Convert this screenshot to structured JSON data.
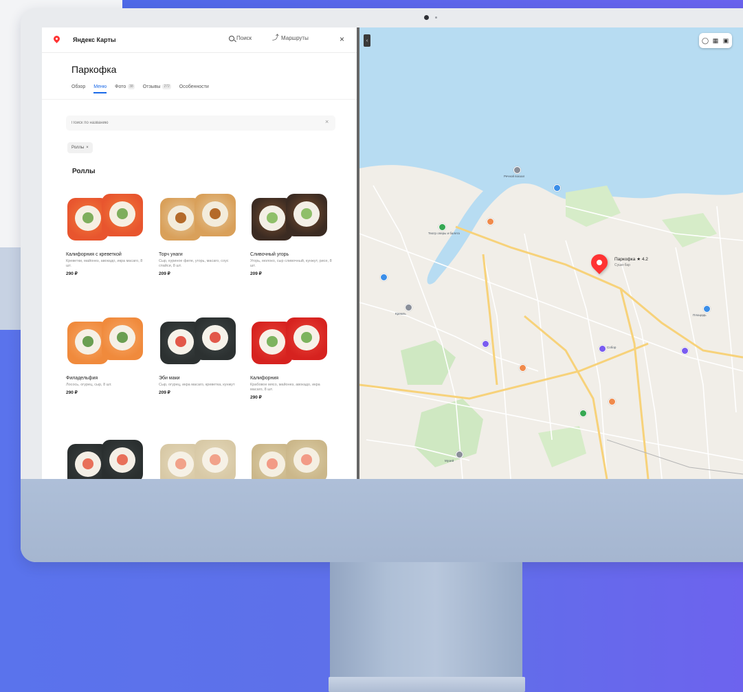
{
  "app": {
    "brand": "Яндекс Карты",
    "search_label": "Поиск",
    "route_label": "Маршруты",
    "close_label": "×"
  },
  "place": {
    "name": "Паркофка",
    "tabs": [
      {
        "label": "Обзор",
        "badge": ""
      },
      {
        "label": "Меню",
        "badge": ""
      },
      {
        "label": "Фото",
        "badge": "38"
      },
      {
        "label": "Отзывы",
        "badge": "272"
      },
      {
        "label": "Особенности",
        "badge": ""
      }
    ],
    "active_tab": "Меню"
  },
  "menu": {
    "search_placeholder": "Поиск по названию",
    "filter_chip": "Роллы",
    "section_title": "Роллы",
    "items": [
      {
        "name": "Калифорния с креветкой",
        "desc": "Креветки, майонез, авокадо, икра масаго, 8 шт.",
        "price": "290 ₽",
        "colors": [
          "#e8552e",
          "#f07a3a",
          "#f6efe2",
          "#7fae5d"
        ]
      },
      {
        "name": "Торч унаги",
        "desc": "Сыр, куриное филе, угорь, масаго, соус спайси, 8 шт.",
        "price": "209 ₽",
        "colors": [
          "#d9a05a",
          "#e6c89a",
          "#f3ecdc",
          "#b46a2a"
        ]
      },
      {
        "name": "Сливочный угорь",
        "desc": "Угорь, молоко, сыр сливочный, кунжут, рисе, 8 шт.",
        "price": "209 ₽",
        "colors": [
          "#3b2b22",
          "#7a4f30",
          "#f3efe6",
          "#8fbf6a"
        ]
      },
      {
        "name": "Филадельфия",
        "desc": "Лосось, огурец, сыр, 8 шт.",
        "price": "290 ₽",
        "colors": [
          "#f08a3c",
          "#f6a868",
          "#f5f0e6",
          "#6a9e52"
        ]
      },
      {
        "name": "Эби маки",
        "desc": "Сыр, огурец, икра масаго, креветка, кунжут",
        "price": "209 ₽",
        "colors": [
          "#2c3131",
          "#3f4646",
          "#f6f2ea",
          "#e2584a"
        ]
      },
      {
        "name": "Калифорния",
        "desc": "Крабовое мясо, майонез, авокадо, икра масаго, 8 шт.",
        "price": "290 ₽",
        "colors": [
          "#d6221f",
          "#e84438",
          "#f7f1e8",
          "#7db35e"
        ]
      },
      {
        "name": "",
        "desc": "",
        "price": "",
        "colors": [
          "#2a2f2f",
          "#3b4141",
          "#f4efe6",
          "#e8705a"
        ]
      },
      {
        "name": "",
        "desc": "",
        "price": "",
        "colors": [
          "#d8c9a6",
          "#e5d9bb",
          "#f6f1e6",
          "#f1a28a"
        ]
      },
      {
        "name": "",
        "desc": "",
        "price": "",
        "colors": [
          "#cbb78a",
          "#ddcfa8",
          "#f5efe2",
          "#f29b86"
        ]
      }
    ]
  },
  "map": {
    "pin_label": "Паркофка",
    "pin_rating": "★ 4.2",
    "pin_sub": "Суши-бар",
    "colors": {
      "water": "#b7dcf2",
      "land": "#f1eee8",
      "park": "#cfe8c2",
      "road_major": "#f7d27a",
      "road_minor": "#ffffff",
      "pin": "#ff3333"
    },
    "poi_labels": [
      "Речной вокзал",
      "Театр оперы и балета",
      "Кремль",
      "Собор",
      "Площадь",
      "Музей"
    ]
  },
  "device": {
    "colors": {
      "background": "#5a73ec",
      "chin": "#aebfd8",
      "frame": "#e9ebee"
    }
  }
}
